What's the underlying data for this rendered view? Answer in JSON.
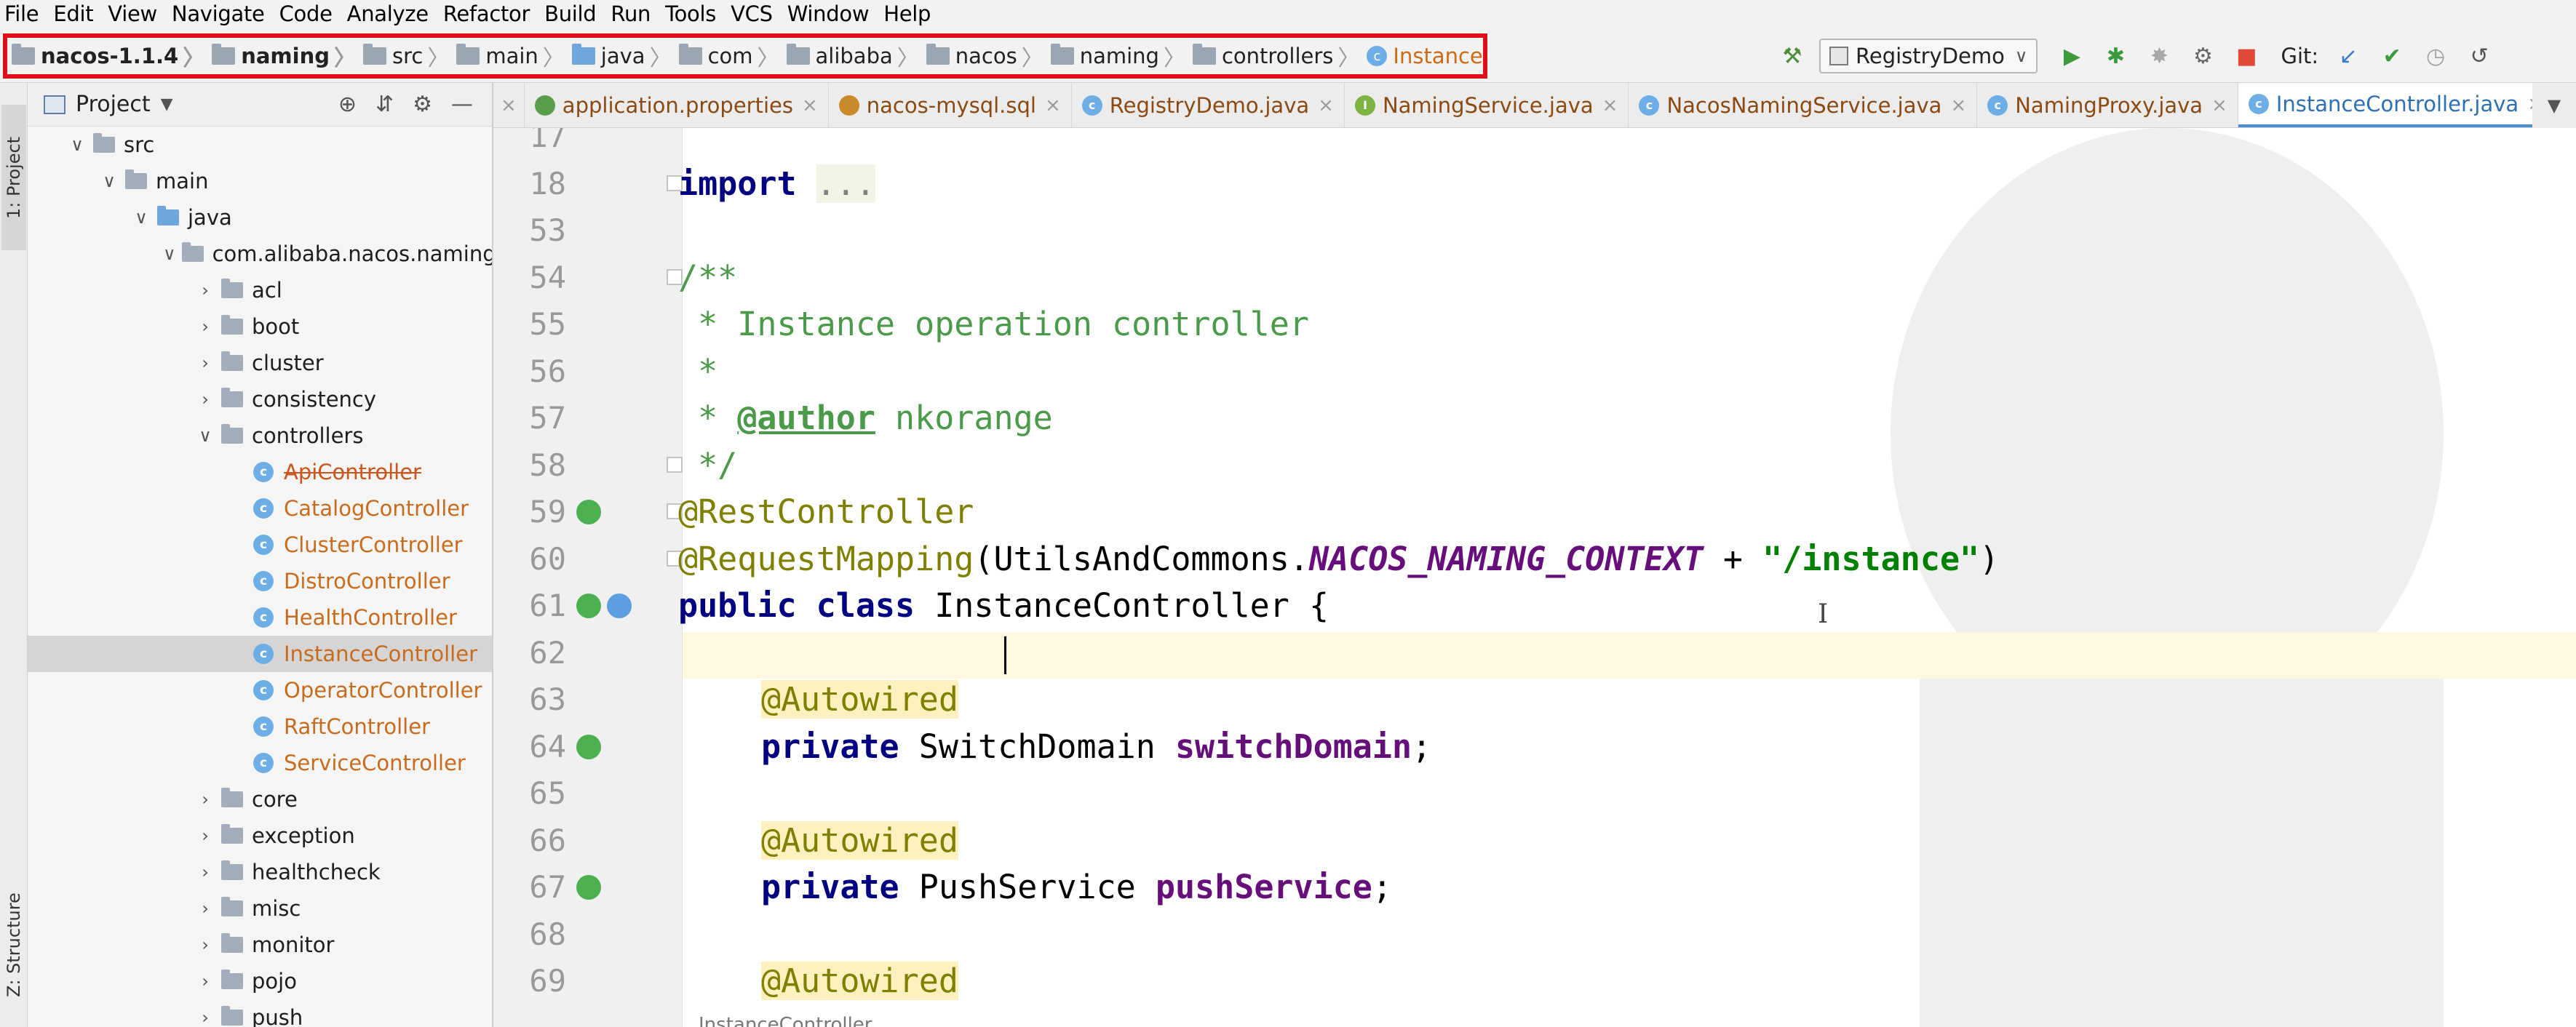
{
  "menu": [
    {
      "label": "File"
    },
    {
      "label": "Edit"
    },
    {
      "label": "View"
    },
    {
      "label": "Navigate"
    },
    {
      "label": "Code"
    },
    {
      "label": "Analyze"
    },
    {
      "label": "Refactor"
    },
    {
      "label": "Build"
    },
    {
      "label": "Run"
    },
    {
      "label": "Tools"
    },
    {
      "label": "VCS"
    },
    {
      "label": "Window"
    },
    {
      "label": "Help"
    }
  ],
  "breadcrumb": [
    "nacos-1.1.4",
    "naming",
    "src",
    "main",
    "java",
    "com",
    "alibaba",
    "nacos",
    "naming",
    "controllers",
    "InstanceController"
  ],
  "toolbar": {
    "run_config": "RegistryDemo",
    "git_label": "Git:"
  },
  "side_tabs": {
    "project": "1: Project",
    "structure": "Z: Structure"
  },
  "project_panel": {
    "title": "Project",
    "tree": [
      {
        "label": "src",
        "kind": "folder",
        "indent": 1,
        "state": "open"
      },
      {
        "label": "main",
        "kind": "folder",
        "indent": 2,
        "state": "open"
      },
      {
        "label": "java",
        "kind": "folder-blue",
        "indent": 3,
        "state": "open"
      },
      {
        "label": "com.alibaba.nacos.naming",
        "kind": "package",
        "indent": 4,
        "state": "open"
      },
      {
        "label": "acl",
        "kind": "package",
        "indent": 5,
        "state": "closed"
      },
      {
        "label": "boot",
        "kind": "package",
        "indent": 5,
        "state": "closed"
      },
      {
        "label": "cluster",
        "kind": "package",
        "indent": 5,
        "state": "closed"
      },
      {
        "label": "consistency",
        "kind": "package",
        "indent": 5,
        "state": "closed"
      },
      {
        "label": "controllers",
        "kind": "package",
        "indent": 5,
        "state": "open"
      },
      {
        "label": "ApiController",
        "kind": "class",
        "indent": 6,
        "strike": true
      },
      {
        "label": "CatalogController",
        "kind": "class",
        "indent": 6
      },
      {
        "label": "ClusterController",
        "kind": "class",
        "indent": 6
      },
      {
        "label": "DistroController",
        "kind": "class",
        "indent": 6
      },
      {
        "label": "HealthController",
        "kind": "class",
        "indent": 6
      },
      {
        "label": "InstanceController",
        "kind": "class",
        "indent": 6,
        "selected": true
      },
      {
        "label": "OperatorController",
        "kind": "class",
        "indent": 6
      },
      {
        "label": "RaftController",
        "kind": "class",
        "indent": 6
      },
      {
        "label": "ServiceController",
        "kind": "class",
        "indent": 6
      },
      {
        "label": "core",
        "kind": "package",
        "indent": 5,
        "state": "closed"
      },
      {
        "label": "exception",
        "kind": "package",
        "indent": 5,
        "state": "closed"
      },
      {
        "label": "healthcheck",
        "kind": "package",
        "indent": 5,
        "state": "closed"
      },
      {
        "label": "misc",
        "kind": "package",
        "indent": 5,
        "state": "closed"
      },
      {
        "label": "monitor",
        "kind": "package",
        "indent": 5,
        "state": "closed"
      },
      {
        "label": "pojo",
        "kind": "package",
        "indent": 5,
        "state": "closed"
      },
      {
        "label": "push",
        "kind": "package",
        "indent": 5,
        "state": "closed"
      }
    ]
  },
  "tabs": [
    {
      "label": "application.properties",
      "icon": "properties-icon",
      "color": "#5a9e4b"
    },
    {
      "label": "nacos-mysql.sql",
      "icon": "sql-icon",
      "color": "#c98a2b"
    },
    {
      "label": "RegistryDemo.java",
      "icon": "class-icon",
      "color": "#6eaee6"
    },
    {
      "label": "NamingService.java",
      "icon": "interface-icon",
      "color": "#7cb342"
    },
    {
      "label": "NacosNamingService.java",
      "icon": "class-icon",
      "color": "#6eaee6"
    },
    {
      "label": "NamingProxy.java",
      "icon": "class-icon",
      "color": "#6eaee6"
    },
    {
      "label": "InstanceController.java",
      "icon": "class-icon",
      "color": "#6eaee6",
      "active": true
    }
  ],
  "editor": {
    "line_numbers": [
      "17",
      "18",
      "53",
      "54",
      "55",
      "56",
      "57",
      "58",
      "59",
      "60",
      "61",
      "62",
      "63",
      "64",
      "65",
      "66",
      "67",
      "68",
      "69"
    ],
    "code": {
      "l18_kw": "import",
      "l18_rest": "...",
      "l54": "/**",
      "l55": " * Instance operation controller",
      "l56": " *",
      "l57_pre": " * ",
      "l57_tag": "@author",
      "l57_rest": " nkorange",
      "l58": " */",
      "l59": "@RestController",
      "l60_ann": "@RequestMapping",
      "l60_a": "(UtilsAndCommons.",
      "l60_const": "NACOS_NAMING_CONTEXT",
      "l60_plus": " + ",
      "l60_str": "\"/instance\"",
      "l60_end": ")",
      "l61_kw": "public class",
      "l61_rest": " InstanceController {",
      "l63": "@Autowired",
      "l64_kw": "private",
      "l64_type": " SwitchDomain ",
      "l64_field": "switchDomain",
      "l64_end": ";",
      "l66": "@Autowired",
      "l67_kw": "private",
      "l67_type": " PushService ",
      "l67_field": "pushService",
      "l67_end": ";",
      "l69": "@Autowired"
    },
    "bottom_breadcrumb": "InstanceController"
  }
}
